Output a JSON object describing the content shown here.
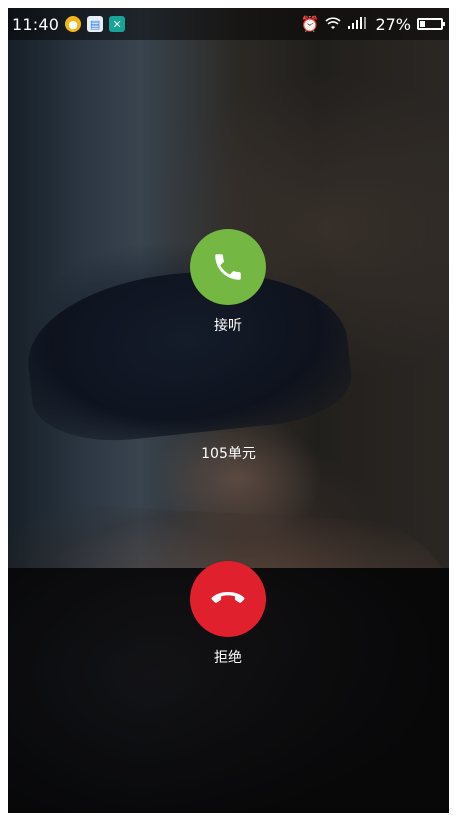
{
  "status_bar": {
    "time": "11:40",
    "battery_percent_text": "27%",
    "battery_level": 0.27,
    "notification_icons": [
      "app-icon-yellow",
      "app-icon-document",
      "app-icon-teal"
    ],
    "system_icons": [
      "alarm-icon",
      "wifi-icon",
      "signal-icon"
    ]
  },
  "call": {
    "caller_name": "105单元",
    "answer_label": "接听",
    "decline_label": "拒绝"
  },
  "colors": {
    "answer": "#74b743",
    "decline": "#e0202c"
  }
}
